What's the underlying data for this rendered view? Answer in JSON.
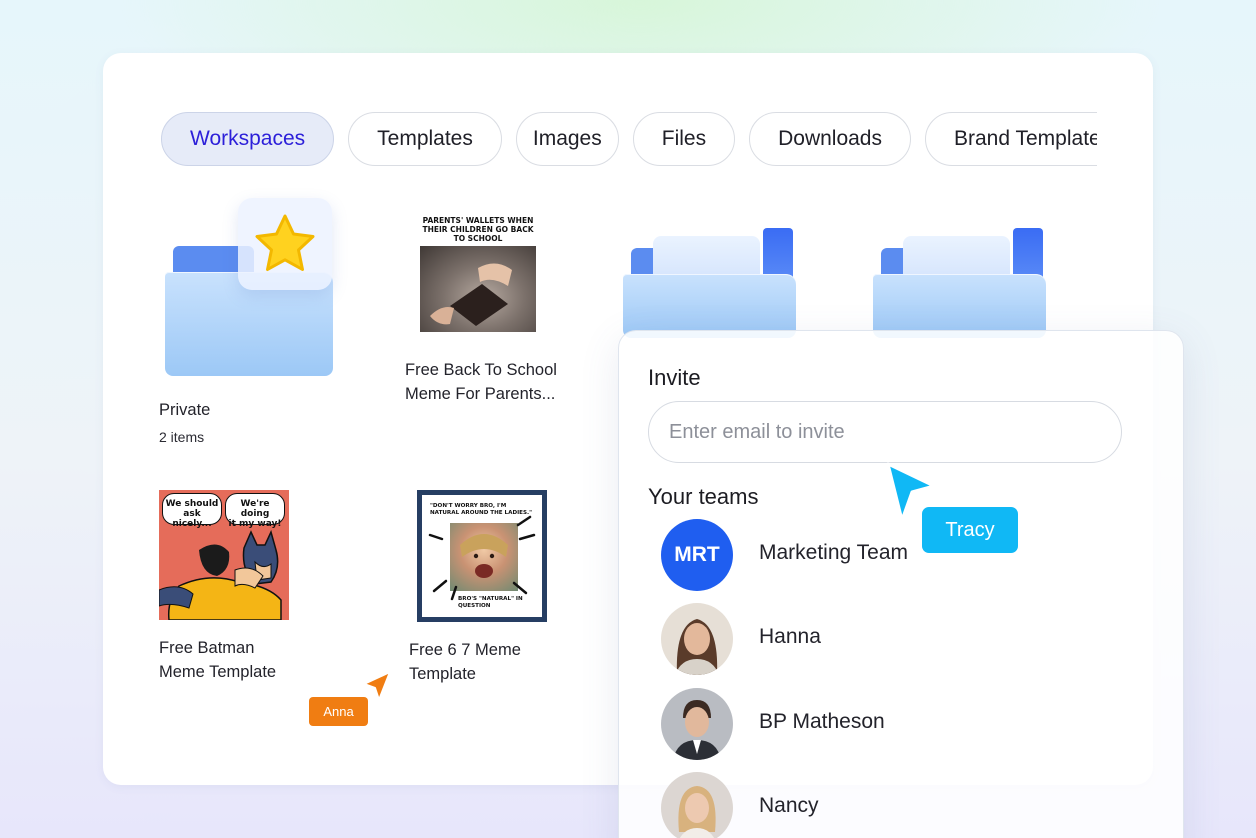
{
  "tabs": [
    {
      "label": "Workspaces",
      "active": true
    },
    {
      "label": "Templates",
      "active": false
    },
    {
      "label": "Images",
      "active": false
    },
    {
      "label": "Files",
      "active": false
    },
    {
      "label": "Downloads",
      "active": false
    },
    {
      "label": "Brand Templates",
      "active": false
    }
  ],
  "grid": {
    "private_folder": {
      "title": "Private",
      "subtitle": "2 items",
      "icon": "star-icon"
    },
    "wallet_meme": {
      "title": "Free Back To School\nMeme For Parents...",
      "caption": "PARENTS' WALLETS WHEN\nTHEIR CHILDREN GO BACK\nTO SCHOOL"
    },
    "batman_meme": {
      "title": "Free Batman\nMeme Template",
      "bubble_left": "We should\nask nicely...",
      "bubble_right": "We're doing\nit my way!"
    },
    "meme_67": {
      "title": "Free 6 7 Meme\nTemplate",
      "top_text": "\"DON'T WORRY BRO, I'M\nNATURAL AROUND THE LADIES.\"",
      "bottom_text": "BRO'S \"NATURAL\" IN\nQUESTION"
    }
  },
  "invite_panel": {
    "heading": "Invite",
    "email_placeholder": "Enter email to invite",
    "teams_heading": "Your teams",
    "teams": [
      {
        "name": "Marketing Team",
        "initials": "MRT"
      },
      {
        "name": "Hanna"
      },
      {
        "name": "BP Matheson"
      },
      {
        "name": "Nancy"
      }
    ]
  },
  "collaborators": [
    {
      "name": "Tracy",
      "color": "#10b8f5"
    },
    {
      "name": "Anna",
      "color": "#f07d12"
    }
  ],
  "colors": {
    "accent": "#2c1fd9",
    "folder_blue": "#9cc8f6",
    "team_avatar": "#1f5ef0"
  }
}
